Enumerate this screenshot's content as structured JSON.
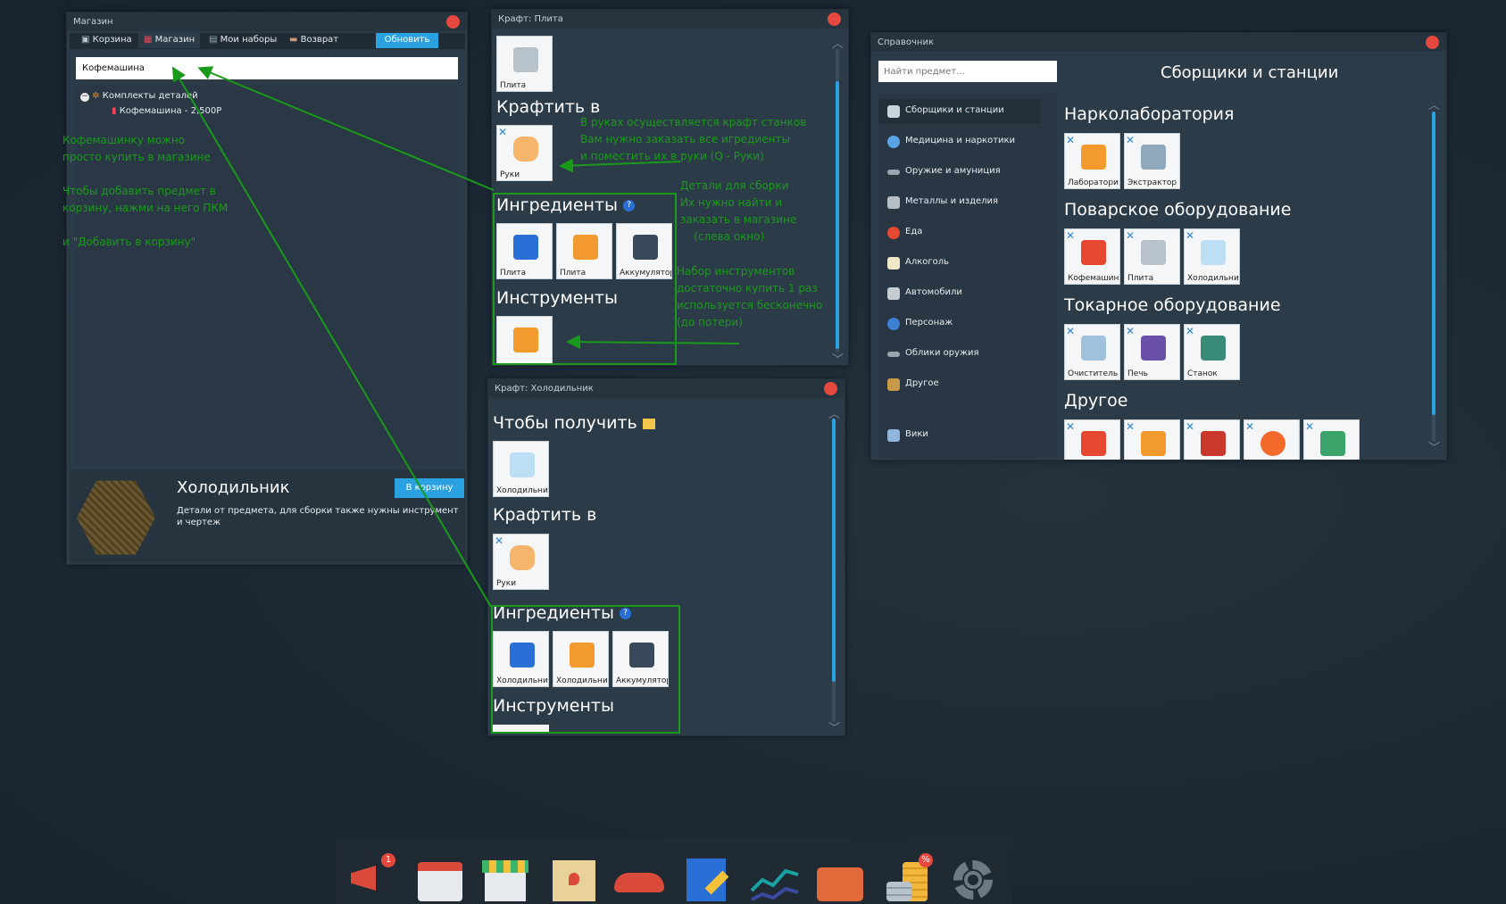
{
  "shop": {
    "title": "Магазин",
    "tabs": [
      "Корзина",
      "Магазин",
      "Мои наборы",
      "Возврат"
    ],
    "refresh_label": "Обновить",
    "search_value": "Кофемашина",
    "tree_group": "Комплекты деталей",
    "tree_item": "Кофемашина - 2,500Р",
    "item_title": "Холодильник",
    "cart_button": "В корзину",
    "item_desc": "Детали от предмета, для сборки также нужны инструмент\nи чертеж"
  },
  "craft1": {
    "title": "Крафт: Плита",
    "top_tile": "Плита",
    "craft_in_heading": "Крафтить в",
    "craft_in_tile": "Руки",
    "ingredients_heading": "Ингредиенты",
    "ingredients": [
      "Плита",
      "Плита",
      "Аккумулятор"
    ],
    "tools_heading": "Инструменты"
  },
  "craft2": {
    "title": "Крафт: Холодильник",
    "obtain_heading": "Чтобы получить",
    "obtain_tile": "Холодильник",
    "craft_in_heading": "Крафтить в",
    "craft_in_tile": "Руки",
    "ingredients_heading": "Ингредиенты",
    "ingredients": [
      "Холодильник",
      "Холодильник",
      "Аккумулятор"
    ],
    "tools_heading": "Инструменты"
  },
  "guide": {
    "title": "Справочник",
    "search_placeholder": "Найти предмет...",
    "heading": "Сборщики и станции",
    "menu": [
      {
        "label": "Сборщики и станции",
        "icon": "tools-icon"
      },
      {
        "label": "Медицина и наркотики",
        "icon": "pill-icon"
      },
      {
        "label": "Оружие и амуниция",
        "icon": "gun-icon"
      },
      {
        "label": "Металлы и изделия",
        "icon": "hammer-icon"
      },
      {
        "label": "Еда",
        "icon": "apple-icon"
      },
      {
        "label": "Алкоголь",
        "icon": "glass-icon"
      },
      {
        "label": "Автомобили",
        "icon": "car-icon"
      },
      {
        "label": "Персонаж",
        "icon": "person-icon"
      },
      {
        "label": "Облики оружия",
        "icon": "gun-skin-icon"
      },
      {
        "label": "Другое",
        "icon": "box-icon"
      }
    ],
    "wiki": "Вики",
    "sections": [
      {
        "title": "Нарколаборатория",
        "items": [
          "Лаборатория",
          "Экстрактор"
        ]
      },
      {
        "title": "Поварское оборудование",
        "items": [
          "Кофемашина",
          "Плита",
          "Холодильник"
        ]
      },
      {
        "title": "Токарное оборудование",
        "items": [
          "Очиститель",
          "Печь",
          "Станок"
        ]
      },
      {
        "title": "Другое",
        "items": [
          "",
          "",
          "",
          "",
          ""
        ]
      }
    ]
  },
  "annotations": {
    "left": "Кофемашинку можно\nпросто купить в магазине\n\nЧтобы добавить предмет в\nкорзину, нажми на него ПКМ\n\nи \"Добавить в корзину\"",
    "craft_in": "В руках осуществляется крафт станков\nВам нужно заказать все игредиенты\nи поместить их в руки (Q - Руки)",
    "parts": "Детали для сборки\nИх нужно найти и\nзаказать в магазине\n    (слева окно)",
    "tools": "Набор инструментов\nдостаточно купить 1 раз\nиспользуется бесконечно\n(до потери)"
  },
  "dock": {
    "badges": [
      "1",
      "%"
    ],
    "icons": [
      "megaphone-icon",
      "calendar-icon",
      "shop-icon",
      "map-icon",
      "car-icon",
      "blueprint-icon",
      "stocks-icon",
      "briefcase-icon",
      "coins-icon",
      "settings-icon"
    ]
  }
}
